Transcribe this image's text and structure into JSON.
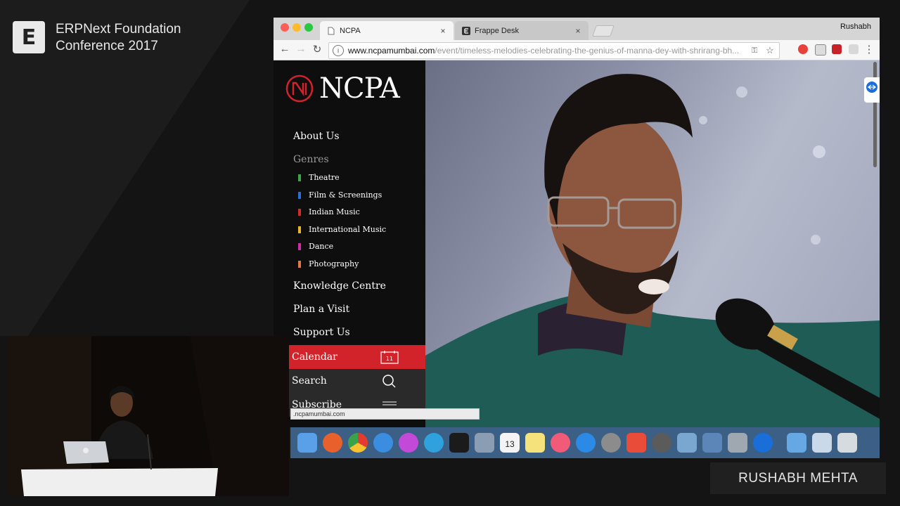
{
  "brand": {
    "logo_letter": "E",
    "title_line1": "ERPNext Foundation",
    "title_line2": "Conference 2017"
  },
  "browser": {
    "tabs": [
      {
        "label": "NCPA",
        "close": "×",
        "active": true
      },
      {
        "label": "Frappe Desk",
        "close": "×",
        "active": false
      }
    ],
    "profile": "Rushabh",
    "url_host": "www.ncpamumbai.com",
    "url_path": "/event/timeless-melodies-celebrating-the-genius-of-manna-dey-with-shrirang-bh...",
    "status_url": ".ncpamumbai.com"
  },
  "site": {
    "logo_text": "NCPA",
    "nav": {
      "about": "About Us",
      "genres": "Genres",
      "knowledge": "Knowledge Centre",
      "plan": "Plan a Visit",
      "support": "Support Us",
      "calendar": "Calendar",
      "calendar_day": "11",
      "search": "Search",
      "subscribe": "Subscribe"
    },
    "genres": [
      {
        "label": "Theatre",
        "color": "#3aa84a"
      },
      {
        "label": "Film & Screenings",
        "color": "#2c6fd1"
      },
      {
        "label": "Indian Music",
        "color": "#d12c2c"
      },
      {
        "label": "International Music",
        "color": "#e6b52a"
      },
      {
        "label": "Dance",
        "color": "#d12ca8"
      },
      {
        "label": "Photography",
        "color": "#e07a4a"
      }
    ]
  },
  "dock": {
    "calendar_day": "13"
  },
  "speaker": {
    "name": "RUSHABH MEHTA"
  }
}
